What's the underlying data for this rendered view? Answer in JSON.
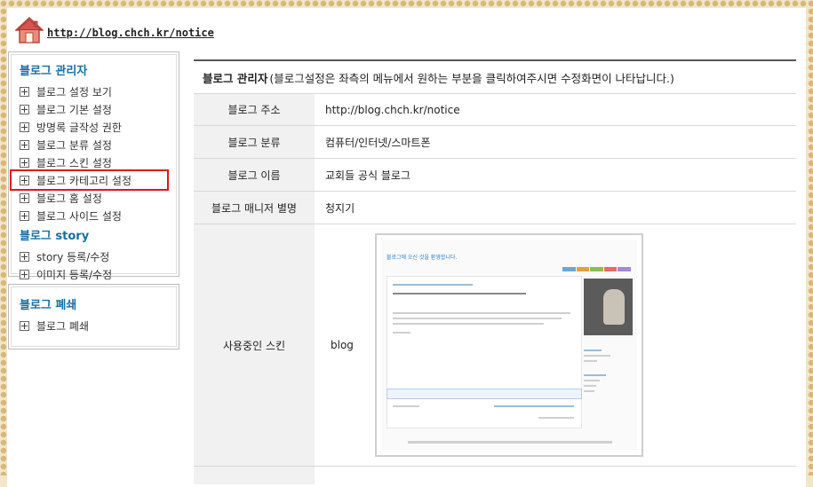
{
  "header": {
    "url_text": "http://blog.chch.kr/notice",
    "icon": "home-icon"
  },
  "sidebar": {
    "admin_title": "블로그 관리자",
    "admin_items": [
      {
        "label": "블로그 설정 보기"
      },
      {
        "label": "블로그 기본 설정"
      },
      {
        "label": "방명록 글작성 권한"
      },
      {
        "label": "블로그 분류 설정"
      },
      {
        "label": "블로그 스킨 설정"
      },
      {
        "label": "블로그 카테고리 설정",
        "selected": true
      },
      {
        "label": "블로그 홈 설정"
      },
      {
        "label": "블로그 사이드 설정"
      }
    ],
    "story_title": "블로그 story",
    "story_items": [
      {
        "label": "story 등록/수정"
      },
      {
        "label": "이미지 등록/수정"
      }
    ],
    "close_title": "블로그 폐쇄",
    "close_items": [
      {
        "label": "블로그 폐쇄"
      }
    ]
  },
  "main": {
    "title_bold": "블로그 관리자",
    "title_desc": "(블로그설정은 좌측의 메뉴에서 원하는 부분을 클릭하여주시면 수정화면이 나타납니다.)",
    "rows": [
      {
        "label": "블로그 주소",
        "value": "http://blog.chch.kr/notice"
      },
      {
        "label": "블로그 분류",
        "value": "컴퓨터/인터넷/스마트폰"
      },
      {
        "label": "블로그 이름",
        "value": "교회들 공식 블로그"
      },
      {
        "label": "블로그 매니저 별명",
        "value": "청지기"
      },
      {
        "label": "사용중인 스킨",
        "value": "blog"
      }
    ],
    "skin_preview_title": "블로그에 오신 것을 환영합니다.",
    "accent_color": "#1b6e9c",
    "selected_outline_color": "#e0141c"
  }
}
